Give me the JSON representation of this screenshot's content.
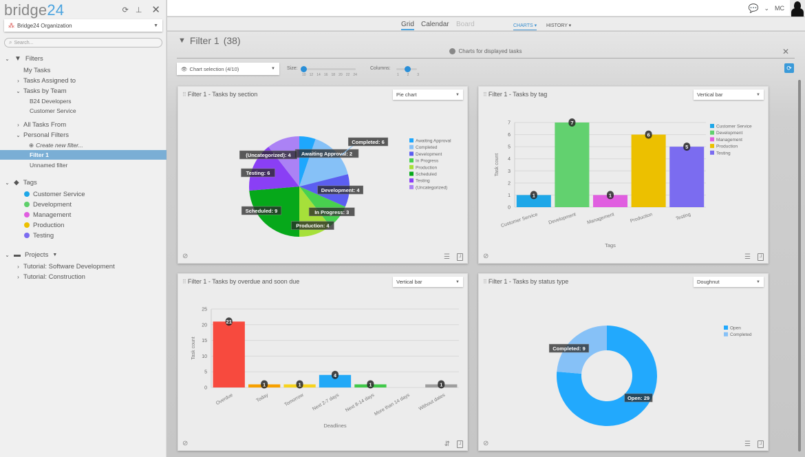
{
  "sidebar": {
    "logo_text": "bridge",
    "logo_num": "24",
    "tools": {
      "refresh": "⟳",
      "pin": "📌",
      "close": "✕"
    },
    "org_select": {
      "value": "Bridge24 Organization"
    },
    "search": {
      "placeholder": "Search..."
    },
    "filters_label": "Filters",
    "items": [
      {
        "label": "My Tasks"
      },
      {
        "label": "Tasks Assigned to"
      },
      {
        "label": "Tasks by Team"
      },
      {
        "label": "B24 Developers"
      },
      {
        "label": "Customer Service"
      },
      {
        "label": "All Tasks From"
      },
      {
        "label": "Personal Filters"
      },
      {
        "label": "Create new filter..."
      },
      {
        "label": "Filter 1"
      },
      {
        "label": "Unnamed filter"
      }
    ],
    "tags_label": "Tags",
    "tags": [
      {
        "label": "Customer Service",
        "color": "#1ea7e8"
      },
      {
        "label": "Development",
        "color": "#5ecf6a"
      },
      {
        "label": "Management",
        "color": "#e05ee0"
      },
      {
        "label": "Production",
        "color": "#ecc000"
      },
      {
        "label": "Testing",
        "color": "#7b6cf0"
      }
    ],
    "projects_label": "Projects",
    "projects": [
      {
        "label": "Tutorial: Software Development"
      },
      {
        "label": "Tutorial: Construction"
      }
    ]
  },
  "topbar": {
    "user_initials": "MC"
  },
  "view_tabs": {
    "grid": "Grid",
    "calendar": "Calendar",
    "board": "Board",
    "charts": "CHARTS ▾",
    "history": "HISTORY ▾"
  },
  "main": {
    "filter_title": "Filter 1",
    "filter_count": "(38)",
    "charts_header": "Charts for displayed tasks",
    "chart_selection": "Chart selection (4/10)",
    "size_label": "Size:",
    "size_ticks": [
      "10",
      "12",
      "14",
      "16",
      "18",
      "20",
      "22",
      "24"
    ],
    "size_value": 10,
    "columns_label": "Columns:",
    "columns_ticks": [
      "1",
      "2",
      "3"
    ],
    "columns_value": 2
  },
  "panels": [
    {
      "title": "Filter 1 - Tasks by section",
      "type": "Pie chart"
    },
    {
      "title": "Filter 1 - Tasks by tag",
      "type": "Vertical bar"
    },
    {
      "title": "Filter 1 - Tasks by overdue and soon due",
      "type": "Vertical bar"
    },
    {
      "title": "Filter 1 - Tasks by status type",
      "type": "Doughnut"
    }
  ],
  "chart_data": [
    {
      "type": "pie",
      "title": "Filter 1 - Tasks by section",
      "categories": [
        "Awaiting Approval",
        "Completed",
        "Development",
        "In Progress",
        "Production",
        "Scheduled",
        "Testing",
        "(Uncategorized)"
      ],
      "values": [
        2,
        6,
        4,
        3,
        4,
        9,
        6,
        4
      ],
      "colors": [
        "#1ea7fd",
        "#86c1f7",
        "#5b5ef0",
        "#48d14f",
        "#a6e03a",
        "#06a81a",
        "#8a3ff5",
        "#ab82f5"
      ],
      "legend": "right"
    },
    {
      "type": "bar",
      "title": "Filter 1 - Tasks by tag",
      "categories": [
        "Customer Service",
        "Development",
        "Management",
        "Production",
        "Testing"
      ],
      "values": [
        1,
        7,
        1,
        6,
        5
      ],
      "colors": [
        "#1ea7e8",
        "#62d16f",
        "#e05ee0",
        "#ecc000",
        "#7b6cf0"
      ],
      "xlabel": "Tags",
      "ylabel": "Task count",
      "ylim": [
        0,
        7
      ],
      "yticks": [
        0,
        1,
        2,
        3,
        4,
        5,
        6,
        7
      ],
      "grid": true,
      "legend": "right"
    },
    {
      "type": "bar",
      "title": "Filter 1 - Tasks by overdue and soon due",
      "categories": [
        "Overdue",
        "Today",
        "Tomorrow",
        "Next 2-7 days",
        "Next 8-14 days",
        "More than 14 days",
        "Without dates"
      ],
      "values": [
        21,
        1,
        1,
        4,
        1,
        0,
        1
      ],
      "colors": [
        "#f74a3e",
        "#f7a000",
        "#f7d31e",
        "#22a9f7",
        "#41c94a",
        "#aaaaaa",
        "#9e9e9e"
      ],
      "xlabel": "Deadlines",
      "ylabel": "Task count",
      "ylim": [
        0,
        25
      ],
      "yticks": [
        0,
        5,
        10,
        15,
        20,
        25
      ],
      "grid": true,
      "legend": "none"
    },
    {
      "type": "pie",
      "subtype": "doughnut",
      "title": "Filter 1 - Tasks by status type",
      "categories": [
        "Open",
        "Completed"
      ],
      "values": [
        29,
        9
      ],
      "colors": [
        "#22a9fd",
        "#86c1f7"
      ],
      "legend": "right"
    }
  ]
}
